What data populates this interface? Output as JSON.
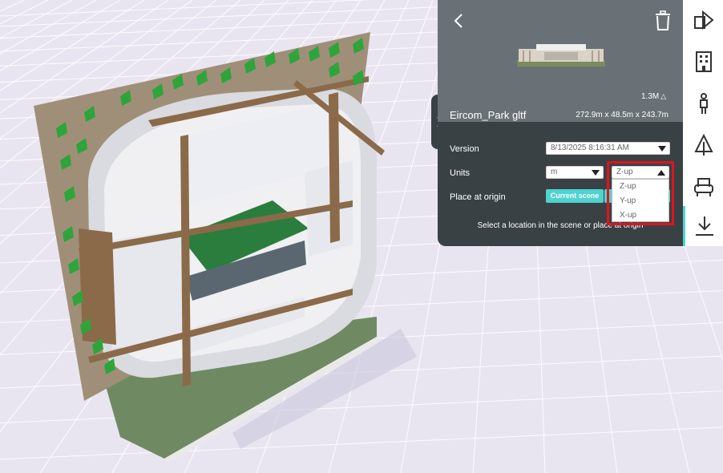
{
  "panel": {
    "model_size": "1.3M",
    "model_name": "Eircom_Park gltf",
    "dimensions": "272.9m x 48.5m x 243.7m",
    "version_label": "Version",
    "version_value": "8/13/2025 8:16:31 AM",
    "units_label": "Units",
    "units_value": "m",
    "axis_value": "Z-up",
    "place_label": "Place at origin",
    "current_scene_label": "Current scene",
    "hint": "Select a location in the scene or place at origin"
  },
  "axis_options": [
    "Z-up",
    "Y-up",
    "X-up"
  ],
  "icons": {
    "back": "chevron-left-icon",
    "trash": "trash-icon",
    "collapse": "chevron-right-icon",
    "tools": [
      "shapes-icon",
      "building-icon",
      "person-icon",
      "tree-icon",
      "armchair-icon",
      "download-icon"
    ]
  },
  "colors": {
    "accent": "#4fd3d0",
    "panel_dark": "#3a4145",
    "panel_header": "#6a7176",
    "highlight": "#e0141b"
  }
}
